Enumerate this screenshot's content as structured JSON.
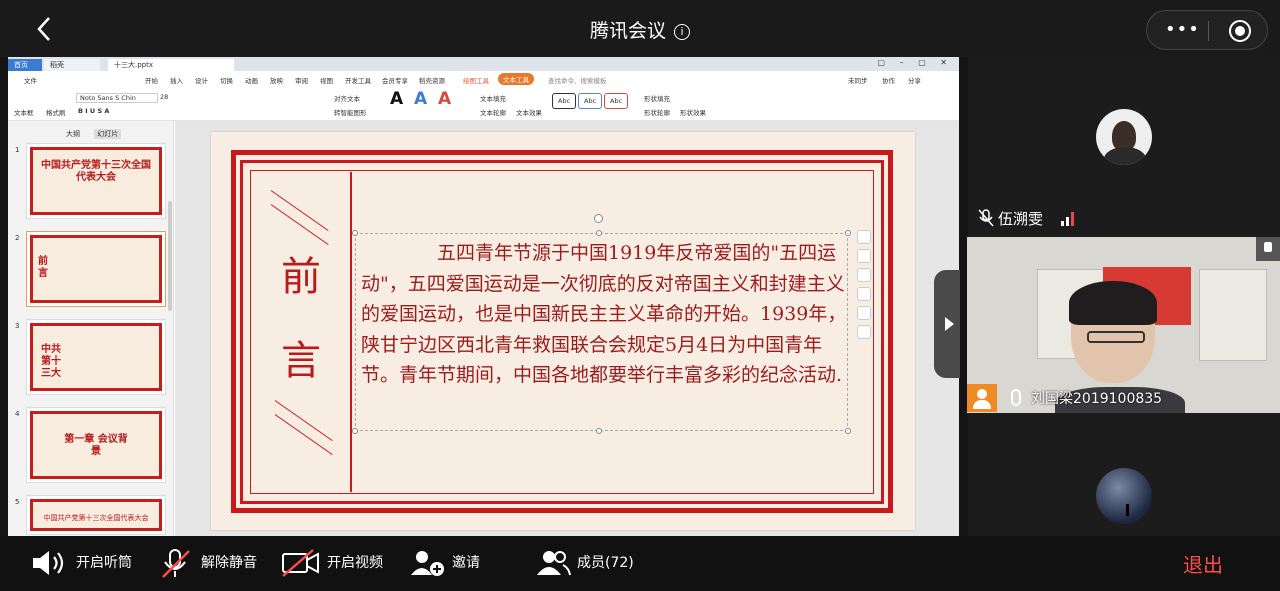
{
  "meeting": {
    "title": "腾讯会议",
    "back_icon": "chevron-left-icon",
    "info_icon": "info-icon",
    "more_label": "•••"
  },
  "share": {
    "tabs": {
      "home": "首页",
      "doc1": "稻壳",
      "doc2": "十三大.pptx"
    },
    "menu": [
      "文件",
      "开始",
      "插入",
      "设计",
      "切换",
      "动画",
      "放映",
      "审阅",
      "视图",
      "开发工具",
      "会员专享",
      "稻壳资源",
      "绘图工具",
      "文本工具"
    ],
    "search": "查找命令、搜索模板",
    "right_menu": [
      "未同步",
      "协作",
      "分享"
    ],
    "ribbon": {
      "font": "Noto Sans S Chin",
      "size": "28",
      "textbox": "文本框",
      "format": "格式刷",
      "align": "对齐文本",
      "smart": "转智能图形",
      "fill": "文本填充",
      "outline": "文本轮廓",
      "effect": "文本效果",
      "shape_fill": "形状填充",
      "shape_outline": "形状轮廓",
      "shape_effect": "形状效果"
    },
    "panel_tabs": [
      "大纲",
      "幻灯片"
    ],
    "thumbs": [
      {
        "num": "1",
        "text": "中国共产党第十三次全国代表大会"
      },
      {
        "num": "2",
        "text": "前言"
      },
      {
        "num": "3",
        "text": "中共第十三大"
      },
      {
        "num": "4",
        "text": "第一章 会议背景"
      },
      {
        "num": "5",
        "text": "中国共产党第十三次全国代表大会"
      }
    ],
    "slide": {
      "heading1": "前",
      "heading2": "言",
      "paragraph": "五四青年节源于中国1919年反帝爱国的\"五四运动\"，五四爱国运动是一次彻底的反对帝国主义和封建主义的爱国运动，也是中国新民主主义革命的开始。1939年，陕甘宁边区西北青年救国联合会规定5月4日为中国青年节。青年节期间，中国各地都要举行丰富多彩的纪念活动."
    }
  },
  "participants": [
    {
      "name": "伍溯雯",
      "muted": true
    },
    {
      "name": "刘国梁2019100835",
      "muted": false
    },
    {
      "name": "",
      "muted": true
    }
  ],
  "toolbar": {
    "speaker": "开启听筒",
    "unmute": "解除静音",
    "video": "开启视频",
    "invite": "邀请",
    "members": "成员(72)",
    "exit": "退出"
  },
  "colors": {
    "accent_red": "#c8191e",
    "exit_red": "#ff4b4b",
    "avatar_orange": "#f08a24"
  }
}
